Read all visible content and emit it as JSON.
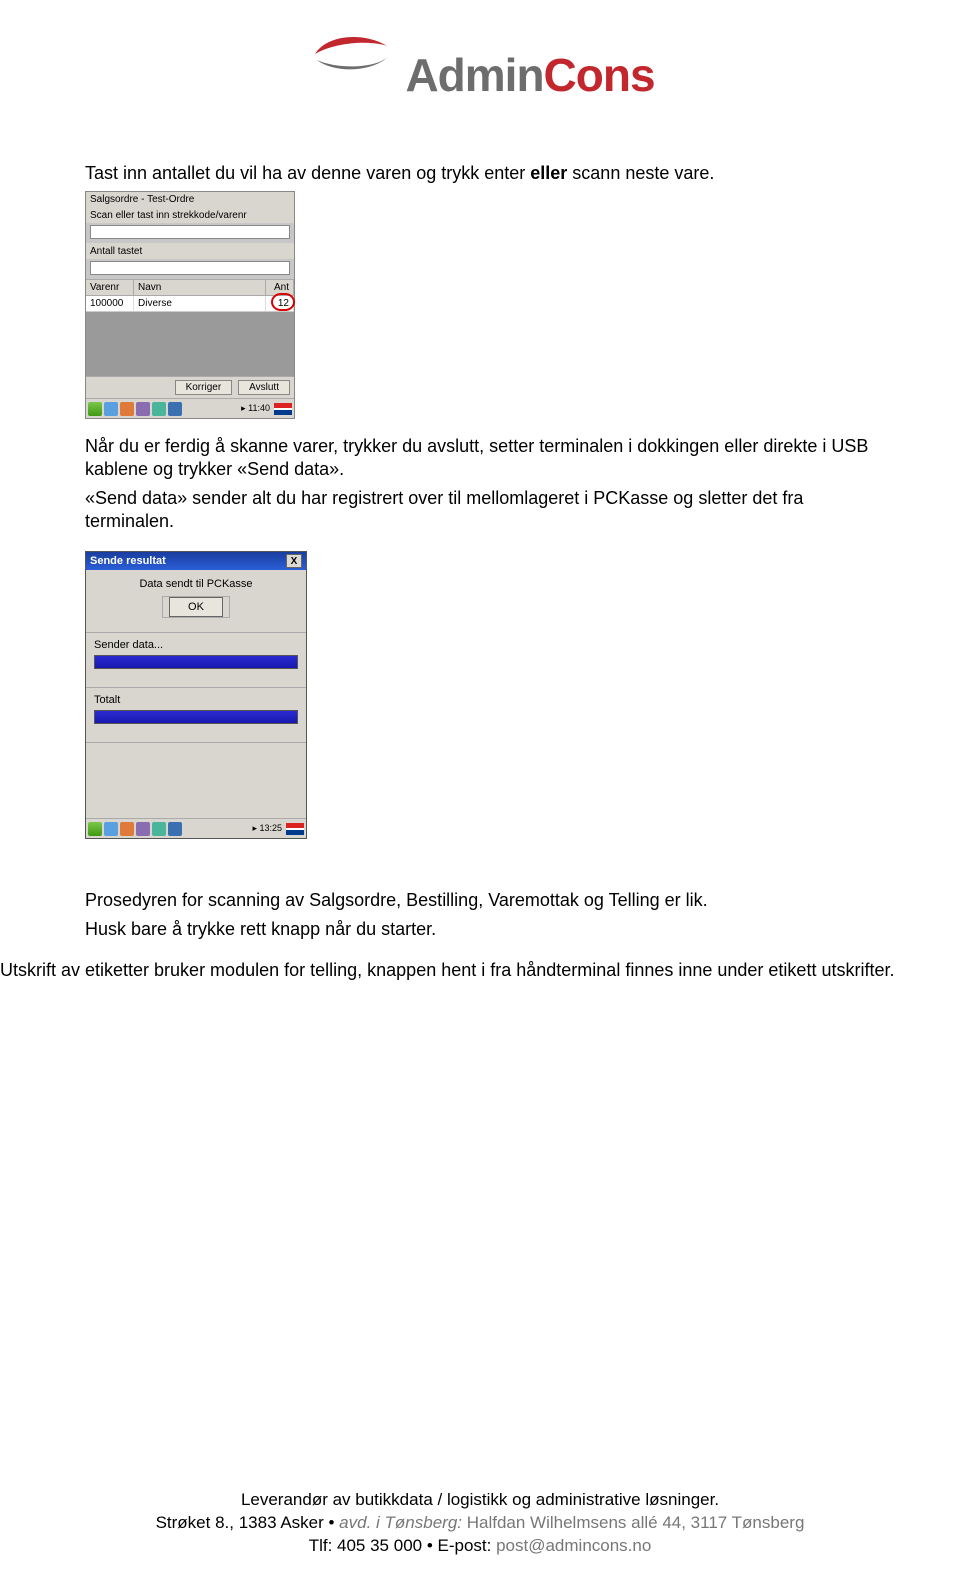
{
  "logo": {
    "part1": "Admin",
    "part2": "Cons"
  },
  "paragraphs": {
    "p1_a": "Tast inn antallet du vil ha av denne varen og trykk enter ",
    "p1_b_bold": "eller",
    "p1_c": " scann neste vare.",
    "p2": "Når du er ferdig å skanne varer, trykker du avslutt, setter terminalen i dokkingen eller direkte i USB kablene og trykker «Send data».",
    "p3": "«Send data» sender alt du har registrert over til mellomlageret i PCKasse og sletter det fra terminalen.",
    "p4": "Prosedyren for scanning av Salgsordre, Bestilling, Varemottak og Telling er lik.",
    "p5": "Husk bare å trykke rett knapp når du starter.",
    "p6": "Utskrift av etiketter bruker modulen for telling, knappen hent i fra håndterminal finnes inne under etikett utskrifter."
  },
  "win1": {
    "title": "Salgsordre - Test-Ordre",
    "scan_label": "Scan eller tast inn strekkode/varenr",
    "antall_label": "Antall tastet",
    "headers": {
      "varenr": "Varenr",
      "navn": "Navn",
      "ant": "Ant"
    },
    "row": {
      "varenr": "100000",
      "navn": "Diverse",
      "ant": "12"
    },
    "btn_korriger": "Korriger",
    "btn_avslutt": "Avslutt",
    "time": "11:40"
  },
  "win2": {
    "title": "Sende resultat",
    "close": "X",
    "msg": "Data sendt til PCKasse",
    "ok": "OK",
    "sender": "Sender data...",
    "totalt": "Totalt",
    "time": "13:25"
  },
  "footer": {
    "line1": "Leverandør av butikkdata / logistikk og administrative løsninger.",
    "l2_a": "Strøket 8., 1383 Asker • ",
    "l2_b_ital": "avd. i Tønsberg: ",
    "l2_c_grey": "Halfdan Wilhelmsens allé 44, 3117 Tønsberg",
    "l3_a": "Tlf: 405 35 000 • E-post: ",
    "l3_b_grey": "post@admincons.no"
  }
}
